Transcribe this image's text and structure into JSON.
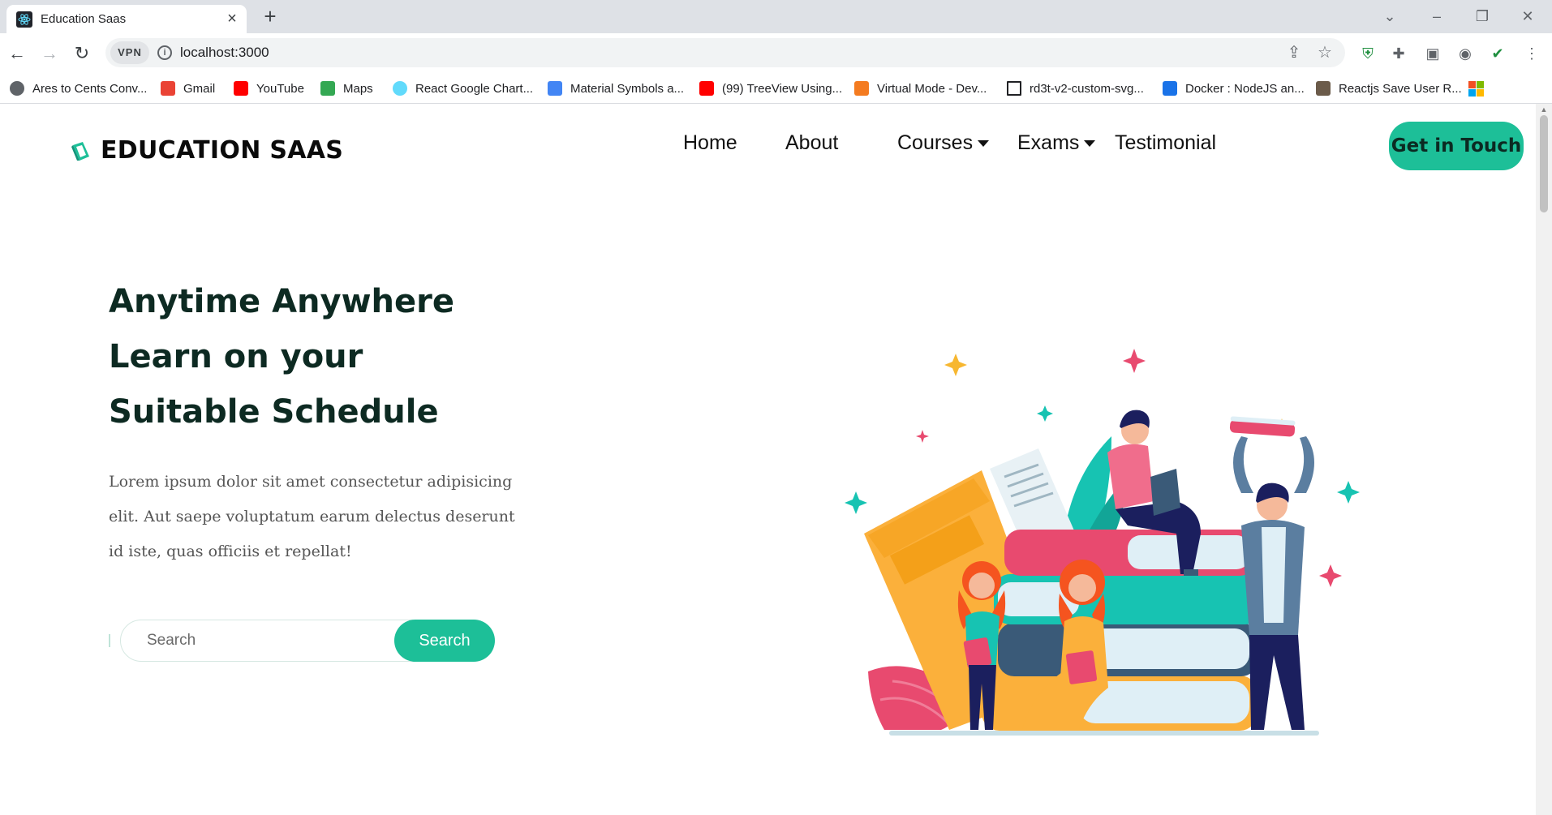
{
  "browser": {
    "tab_title": "Education Saas",
    "url": "localhost:3000",
    "vpn_label": "VPN",
    "bookmarks": [
      {
        "label": "Ares to Cents Conv...",
        "icon": "globe-icon",
        "color": "#5f6368"
      },
      {
        "label": "Gmail",
        "icon": "gmail-icon",
        "color": "#ea4335"
      },
      {
        "label": "YouTube",
        "icon": "youtube-icon",
        "color": "#ff0000"
      },
      {
        "label": "Maps",
        "icon": "maps-icon",
        "color": "#34a853"
      },
      {
        "label": "React Google Chart...",
        "icon": "react-icon",
        "color": "#61dafb"
      },
      {
        "label": "Material Symbols a...",
        "icon": "material-icon",
        "color": "#4285f4"
      },
      {
        "label": "(99) TreeView Using...",
        "icon": "youtube-icon",
        "color": "#ff0000"
      },
      {
        "label": "Virtual Mode - Dev...",
        "icon": "devexpress-icon",
        "color": "#f47b20"
      },
      {
        "label": "rd3t-v2-custom-svg...",
        "icon": "page-icon",
        "color": "#202124"
      },
      {
        "label": "Docker : NodeJS an...",
        "icon": "blogger-icon",
        "color": "#1a73e8"
      },
      {
        "label": "Reactjs Save User R...",
        "icon": "photo-icon",
        "color": "#6b5b4a"
      }
    ]
  },
  "site": {
    "brand": "EDUCATION SAAS",
    "nav": [
      {
        "label": "Home",
        "dropdown": false
      },
      {
        "label": "About",
        "dropdown": false
      },
      {
        "label": "Courses",
        "dropdown": true
      },
      {
        "label": "Exams",
        "dropdown": true
      },
      {
        "label": "Testimonial",
        "dropdown": false
      }
    ],
    "cta_label": "Get in Touch",
    "hero": {
      "line1": "Anytime Anywhere",
      "line2": "Learn on your",
      "line3": "Suitable Schedule",
      "description": "Lorem ipsum dolor sit amet consectetur adipisicing elit. Aut saepe voluptatum earum delectus deserunt id iste, quas officiis et repellat!"
    },
    "search": {
      "placeholder": "Search",
      "button_label": "Search"
    }
  },
  "colors": {
    "accent": "#1dbf98",
    "heading": "#0d2a22"
  }
}
